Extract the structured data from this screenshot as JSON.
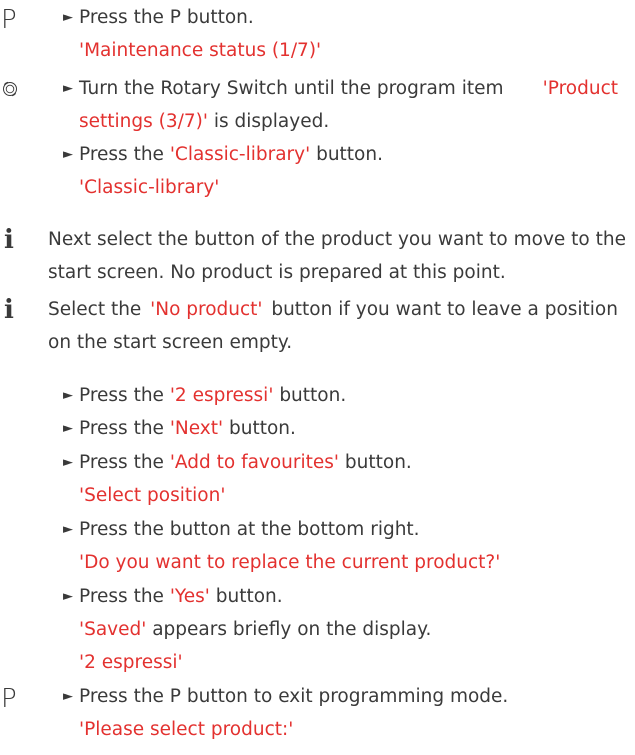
{
  "symbols": {
    "p_button": "P",
    "info": "i",
    "bullet": "►",
    "rotary_icon": "rotary-switch-icon"
  },
  "step1": {
    "text": "Press the P button.",
    "result": "'Maintenance status (1/7)'"
  },
  "step2": {
    "pre": "Turn the Rotary Switch until the program item",
    "item_a": "'Product",
    "item_b": "settings (3/7)'",
    "post": "is displayed."
  },
  "step3": {
    "pre": "Press the",
    "button": "'Classic-library'",
    "post": "button.",
    "result": "'Classic-library'"
  },
  "info1": {
    "line1": "Next select the button of the product you want to move to the",
    "line2": "start screen. No product is prepared at this point."
  },
  "info2": {
    "pre": "Select the",
    "button": "'No product'",
    "mid": "button if you want to leave a position",
    "line2": "on the start screen empty."
  },
  "step4": {
    "pre": "Press the",
    "button": "'2 espressi'",
    "post": "button."
  },
  "step5": {
    "pre": "Press the",
    "button": "'Next'",
    "post": "button."
  },
  "step6": {
    "pre": "Press the",
    "button": "'Add to favourites'",
    "post": "button.",
    "result": "'Select position'"
  },
  "step7": {
    "text": "Press the button at the bottom right.",
    "result": "'Do you want to replace the current product?'"
  },
  "step8": {
    "pre": "Press the",
    "button": "'Yes'",
    "post": "button.",
    "result_a": "'Saved'",
    "result_b": "appears briefly on the display.",
    "result_c": "'2 espressi'"
  },
  "step9": {
    "text": "Press the P button to exit programming mode.",
    "result": "'Please select product:'"
  },
  "colors": {
    "text": "#3a3a3a",
    "highlight": "#e3312f"
  }
}
